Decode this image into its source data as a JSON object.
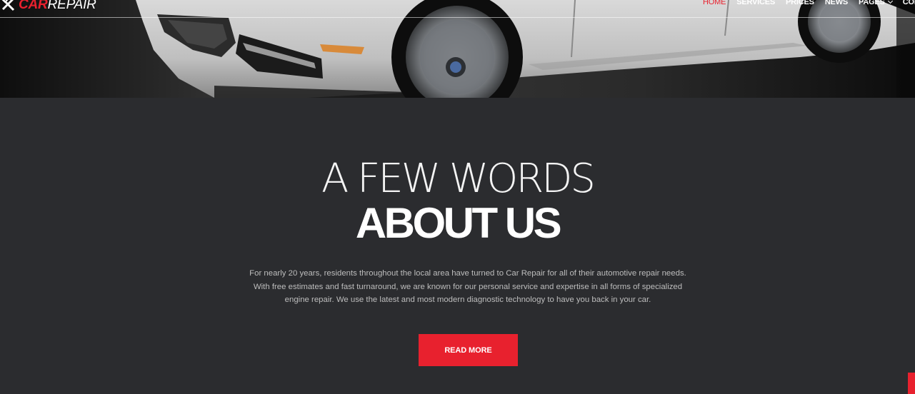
{
  "brand": {
    "logo_car": "CAR",
    "logo_repair": "REPAIR"
  },
  "nav": {
    "items": [
      {
        "label": "HOME",
        "active": true
      },
      {
        "label": "SERVICES"
      },
      {
        "label": "PRICES"
      },
      {
        "label": "NEWS"
      },
      {
        "label": "PAGES",
        "has_dropdown": true
      },
      {
        "label": "CON"
      }
    ]
  },
  "about": {
    "title_light": "A FEW WORDS",
    "title_bold": "ABOUT US",
    "paragraph_line1": "For nearly 20 years, residents throughout the local area have turned to Car Repair for all of their automotive repair needs.",
    "paragraph_line2": "With free estimates and fast turnaround, we are known for our personal service and expertise in all forms of specialized",
    "paragraph_line3": "engine repair. We use the latest and most modern diagnostic technology to have you back in your car.",
    "button_label": "READ MORE"
  },
  "colors": {
    "accent": "#e8212e",
    "background": "#2b2c2f",
    "text_muted": "#bdbdbd"
  },
  "icons": {
    "logo": "wrench-icon",
    "dropdown": "chevron-down-icon"
  }
}
